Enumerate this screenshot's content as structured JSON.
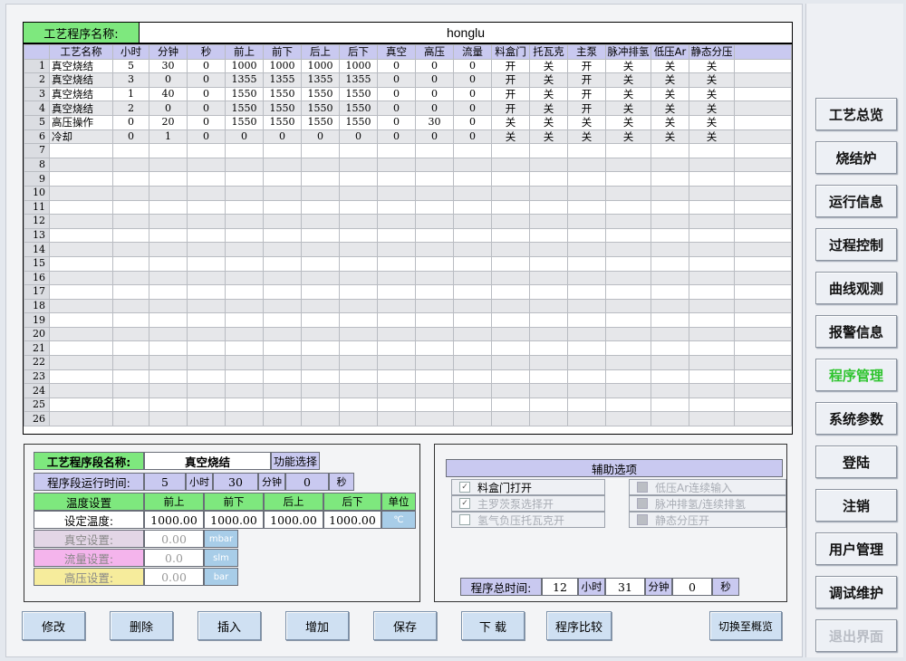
{
  "program": {
    "label": "工艺程序名称:",
    "name": "honglu"
  },
  "table": {
    "headers": [
      "工艺名称",
      "小时",
      "分钟",
      "秒",
      "前上",
      "前下",
      "后上",
      "后下",
      "真空",
      "高压",
      "流量",
      "料盒门",
      "托瓦克",
      "主泵",
      "脉冲排氢",
      "低压Ar",
      "静态分压"
    ],
    "rows": [
      [
        "真空烧结",
        "5",
        "30",
        "0",
        "1000",
        "1000",
        "1000",
        "1000",
        "0",
        "0",
        "0",
        "开",
        "关",
        "开",
        "关",
        "关",
        "关"
      ],
      [
        "真空烧结",
        "3",
        "0",
        "0",
        "1355",
        "1355",
        "1355",
        "1355",
        "0",
        "0",
        "0",
        "开",
        "关",
        "开",
        "关",
        "关",
        "关"
      ],
      [
        "真空烧结",
        "1",
        "40",
        "0",
        "1550",
        "1550",
        "1550",
        "1550",
        "0",
        "0",
        "0",
        "开",
        "关",
        "开",
        "关",
        "关",
        "关"
      ],
      [
        "真空烧结",
        "2",
        "0",
        "0",
        "1550",
        "1550",
        "1550",
        "1550",
        "0",
        "0",
        "0",
        "开",
        "关",
        "开",
        "关",
        "关",
        "关"
      ],
      [
        "高压操作",
        "0",
        "20",
        "0",
        "1550",
        "1550",
        "1550",
        "1550",
        "0",
        "30",
        "0",
        "关",
        "关",
        "关",
        "关",
        "关",
        "关"
      ],
      [
        "冷却",
        "0",
        "1",
        "0",
        "0",
        "0",
        "0",
        "0",
        "0",
        "0",
        "0",
        "关",
        "关",
        "关",
        "关",
        "关",
        "关"
      ]
    ],
    "row_numbers": [
      "1",
      "2",
      "3",
      "4",
      "5",
      "6",
      "7",
      "8",
      "9",
      "10",
      "11",
      "12",
      "13",
      "14",
      "15",
      "16",
      "17",
      "18",
      "19",
      "20",
      "21",
      "22",
      "23",
      "24",
      "25",
      "26"
    ]
  },
  "segment": {
    "name_label": "工艺程序段名称:",
    "name_value": "真空烧结",
    "func_select": "功能选择",
    "runtime_label": "程序段运行时间:",
    "hours": "5",
    "hours_unit": "小时",
    "minutes": "30",
    "minutes_unit": "分钟",
    "seconds": "0",
    "seconds_unit": "秒",
    "temp_label": "温度设置",
    "temp_cols": [
      "前上",
      "前下",
      "后上",
      "后下"
    ],
    "unit_label": "单位",
    "set_temp_label": "设定温度:",
    "set_temps": [
      "1000.00",
      "1000.00",
      "1000.00",
      "1000.00"
    ],
    "temp_unit": "℃",
    "vacuum_label": "真空设置:",
    "vacuum_value": "0.00",
    "vacuum_unit": "mbar",
    "flow_label": "流量设置:",
    "flow_value": "0.0",
    "flow_unit": "slm",
    "pressure_label": "高压设置:",
    "pressure_value": "0.00",
    "pressure_unit": "bar"
  },
  "aux": {
    "title": "辅助选项",
    "options_left": [
      {
        "label": "料盒门打开",
        "checked": "✓"
      },
      {
        "label": "主罗茨泵选择开",
        "checked": "✓"
      },
      {
        "label": "氢气负压托瓦克开",
        "checked": ""
      }
    ],
    "options_right": [
      {
        "label": "低压Ar连续输入"
      },
      {
        "label": "脉冲排氢/连续排氢"
      },
      {
        "label": "静态分压开"
      }
    ],
    "total_label": "程序总时间:",
    "total_hours": "12",
    "total_hours_unit": "小时",
    "total_minutes": "31",
    "total_minutes_unit": "分钟",
    "total_seconds": "0",
    "total_seconds_unit": "秒"
  },
  "buttons": [
    "修改",
    "删除",
    "插入",
    "增加",
    "保存",
    "下 载",
    "程序比较",
    "切换至概览"
  ],
  "side": [
    "工艺总览",
    "烧结炉",
    "运行信息",
    "过程控制",
    "曲线观测",
    "报警信息",
    "程序管理",
    "系统参数",
    "登陆",
    "注销",
    "用户管理",
    "调试维护",
    "退出界面"
  ],
  "colors": {
    "green_label": "#7ee87e",
    "header_purple": "#c9c9f0",
    "active_green": "#2ec42e",
    "unit_blue": "#a8cde8"
  }
}
